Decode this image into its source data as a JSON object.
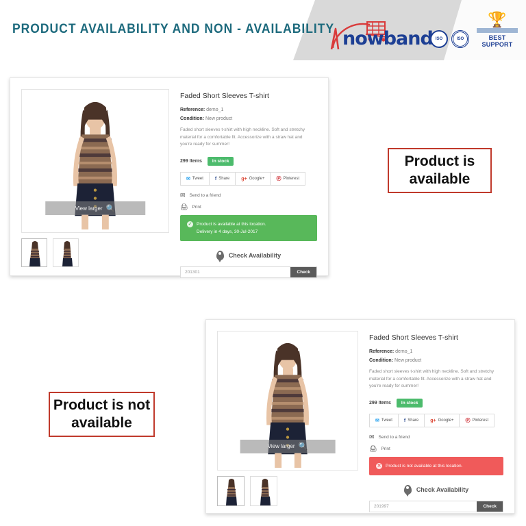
{
  "header": {
    "title": "PRODUCT AVAILABILITY AND NON - AVAILABILITY",
    "brand_name": "nowband",
    "brand_initial": "K",
    "badges": {
      "seal_1": "ISO",
      "seal_2": "ISO",
      "support_label": "BEST SUPPORT"
    },
    "title_color": "#1d6a7d",
    "brand_color": "#1d3f94",
    "cart_color": "#d93b3b"
  },
  "product": {
    "title": "Faded Short Sleeves T-shirt",
    "reference_label": "Reference:",
    "reference_value": "demo_1",
    "condition_label": "Condition:",
    "condition_value": "New product",
    "description": "Faded short sleeves t-shirt with high neckline. Soft and stretchy material for a comfortable fit. Accessorize with a straw hat and you're ready for summer!",
    "items_count": "299 Items",
    "stock_badge": "In stock",
    "zoom_overlay": "View larger",
    "social": [
      {
        "icon": "twitter-icon",
        "glyph": "✉",
        "label": "Tweet"
      },
      {
        "icon": "facebook-icon",
        "glyph": "f",
        "label": "Share"
      },
      {
        "icon": "google-plus-icon",
        "glyph": "g+",
        "label": "Google+"
      },
      {
        "icon": "pinterest-icon",
        "glyph": "Ⓟ",
        "label": "Pinterest"
      }
    ],
    "send_to_friend": "Send to a friend",
    "print": "Print",
    "check_availability": "Check Availability",
    "check_button": "Check"
  },
  "card_available": {
    "alert_line_1": "Product is available at this location.",
    "alert_line_2": "Delivery in 4 days, 30-Jul-2017",
    "alert_color": "#58b85a",
    "zip_value": "201301",
    "zip_placeholder": "201301"
  },
  "card_not_available": {
    "alert_line_1": "Product is not available at this location.",
    "alert_color": "#f05a5a",
    "zip_value": "201997",
    "zip_placeholder": "201997"
  },
  "callouts": {
    "available": "Product is available",
    "not_available": "Product is not available",
    "border_color": "#c0392b"
  }
}
